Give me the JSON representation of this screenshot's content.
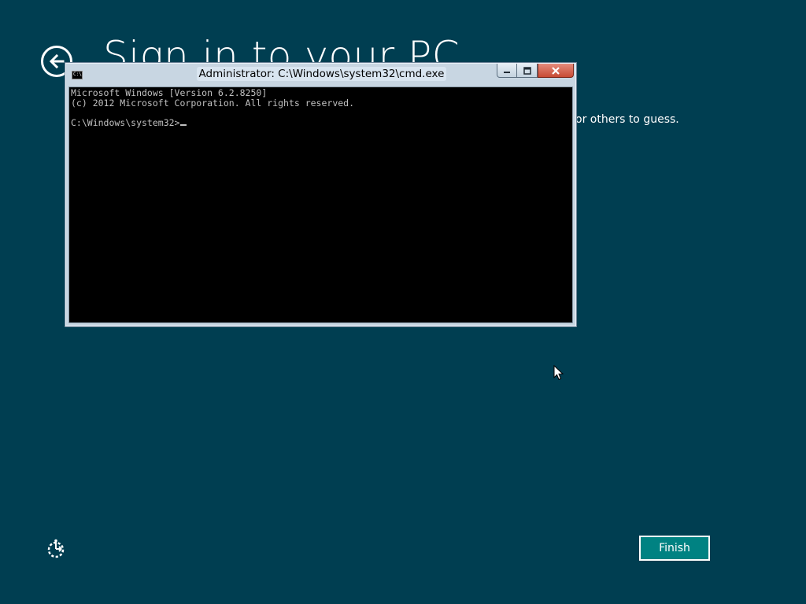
{
  "setup": {
    "title": "Sign in to your PC",
    "description_visible": "or others to guess.",
    "finish_label": "Finish"
  },
  "cmd_window": {
    "title": "Administrator: C:\\Windows\\system32\\cmd.exe",
    "icon_text": "C:\\",
    "console_lines": [
      "Microsoft Windows [Version 6.2.8250]",
      "(c) 2012 Microsoft Corporation. All rights reserved.",
      "",
      "C:\\Windows\\system32>"
    ]
  },
  "colors": {
    "background": "#003e51",
    "finish_button": "#008282",
    "close_button": "#c74a34"
  },
  "icons": {
    "back": "back-arrow-icon",
    "ease_of_access": "ease-of-access-icon",
    "minimize": "minimize-icon",
    "maximize": "maximize-icon",
    "close": "close-icon"
  }
}
